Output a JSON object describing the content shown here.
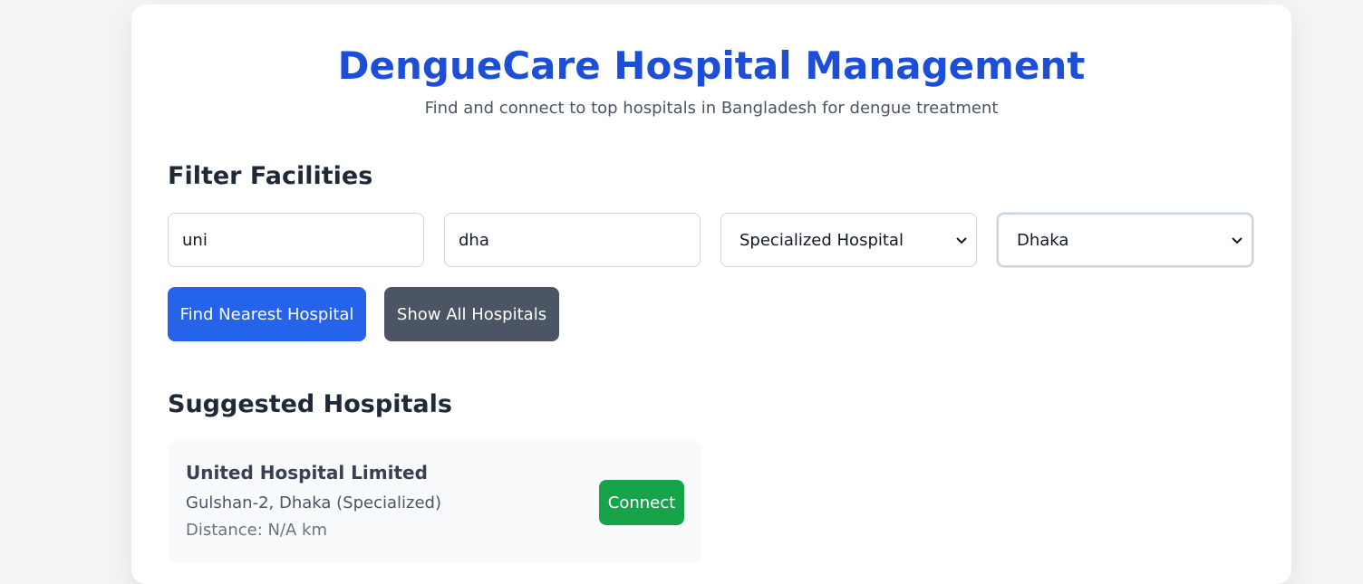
{
  "header": {
    "title": "DengueCare Hospital Management",
    "subtitle": "Find and connect to top hospitals in Bangladesh for dengue treatment"
  },
  "filters": {
    "heading": "Filter Facilities",
    "name_input_value": "uni",
    "location_input_value": "dha",
    "type_selected": "Specialized Hospital",
    "division_selected": "Dhaka"
  },
  "actions": {
    "find_nearest_label": "Find Nearest Hospital",
    "show_all_label": "Show All Hospitals"
  },
  "suggested": {
    "heading": "Suggested Hospitals",
    "hospitals": [
      {
        "name": "United Hospital Limited",
        "address": "Gulshan-2, Dhaka (Specialized)",
        "distance": "Distance: N/A km",
        "connect_label": "Connect"
      }
    ]
  },
  "colors": {
    "accent": "#1d4ed8",
    "primary_button": "#2563eb",
    "secondary_button": "#4b5563",
    "connect_button": "#16a34a"
  }
}
